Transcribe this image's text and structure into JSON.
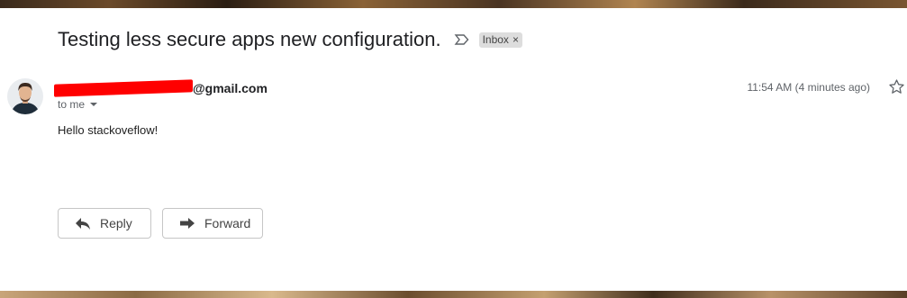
{
  "email": {
    "subject": "Testing less secure apps new configuration.",
    "label": "Inbox",
    "label_remove": "×",
    "sender_domain": "@gmail.com",
    "to_text": "to me",
    "time": "11:54 AM (4 minutes ago)",
    "body": "Hello stackoveflow!"
  },
  "actions": {
    "reply_label": "Reply",
    "forward_label": "Forward"
  },
  "colors": {
    "redaction": "#ff0000"
  }
}
